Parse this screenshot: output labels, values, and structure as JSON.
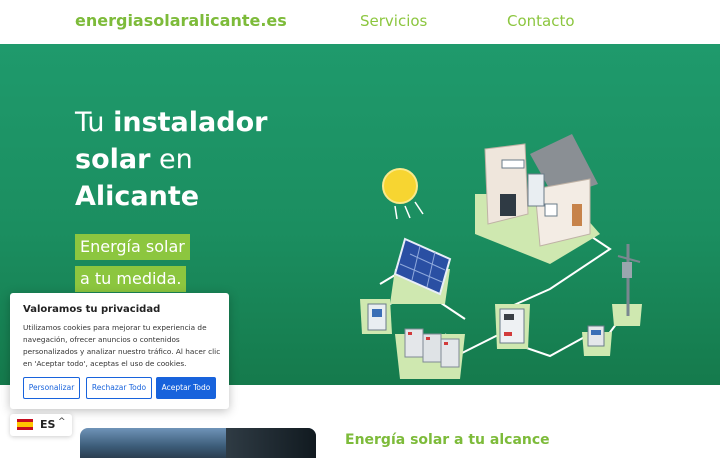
{
  "header": {
    "logo": "energiasolaralicante.es",
    "nav": [
      "Servicios",
      "Contacto"
    ]
  },
  "hero": {
    "title_line1_light": "Tu ",
    "title_line1_bold": "instalador",
    "title_line2_bold": "solar",
    "title_line2_light": " en",
    "title_line3_bold": "Alicante",
    "tag1": "Energía solar",
    "tag2": "a tu medida."
  },
  "section": {
    "title": "Energía solar a tu alcance"
  },
  "cookie": {
    "title": "Valoramos tu privacidad",
    "text": "Utilizamos cookies para mejorar tu experiencia de navegación, ofrecer anuncios o contenidos personalizados y analizar nuestro tráfico. Al hacer clic en 'Aceptar todo', aceptas el uso de cookies.",
    "btn_customize": "Personalizar",
    "btn_reject": "Rechazar Todo",
    "btn_accept": "Aceptar Todo"
  },
  "language": {
    "code": "ES",
    "chevron": "^"
  },
  "colors": {
    "brand_green": "#8cc63f",
    "hero_green": "#1f9a6c",
    "cookie_blue": "#1863dc"
  }
}
